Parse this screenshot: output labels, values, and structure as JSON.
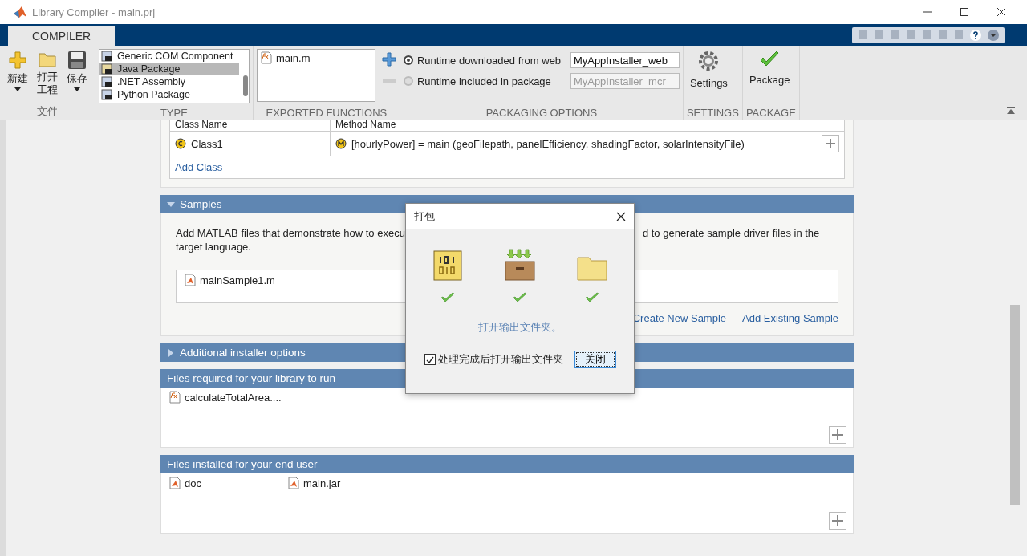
{
  "window": {
    "title": "Library Compiler - main.prj"
  },
  "ribbon": {
    "tabs": [
      {
        "label": "COMPILER",
        "selected": true
      }
    ],
    "file_group": {
      "label": "文件",
      "buttons": [
        {
          "label": "新建",
          "kind": "new",
          "dropdown": true
        },
        {
          "label": "打开工程",
          "kind": "open",
          "dropdown": false
        },
        {
          "label": "保存",
          "kind": "save",
          "dropdown": true
        }
      ]
    },
    "type_group": {
      "label": "TYPE",
      "items": [
        {
          "label": "Generic COM Component",
          "kind": "com",
          "selected": false
        },
        {
          "label": "Java Package",
          "kind": "java",
          "selected": true
        },
        {
          "label": ".NET Assembly",
          "kind": "net",
          "selected": false
        },
        {
          "label": "Python Package",
          "kind": "python",
          "selected": false
        }
      ]
    },
    "exported_functions": {
      "label": "EXPORTED FUNCTIONS",
      "files": [
        "main.m"
      ]
    },
    "packaging_options": {
      "label": "PACKAGING OPTIONS",
      "options": [
        {
          "label": "Runtime downloaded from web",
          "value": "MyAppInstaller_web",
          "selected": true
        },
        {
          "label": "Runtime included in package",
          "value": "MyAppInstaller_mcr",
          "selected": false
        }
      ]
    },
    "settings": {
      "label": "SETTINGS",
      "button": "Settings"
    },
    "package": {
      "label": "PACKAGE",
      "button": "Package"
    }
  },
  "class_table": {
    "columns": [
      "Class Name",
      "Method Name"
    ],
    "rows": [
      {
        "class": "Class1",
        "method": "[hourlyPower] = main (geoFilepath, panelEfficiency, shadingFactor, solarIntensityFile)"
      }
    ],
    "add_link": "Add Class"
  },
  "sections": [
    {
      "kind": "samples",
      "title": "Samples",
      "expanded": true,
      "description": "Add MATLAB files that demonstrate how to execu",
      "description_end": "d to generate sample driver files in the target language.",
      "files": [
        "mainSample1.m"
      ],
      "links": [
        "Create New Sample",
        "Add Existing Sample"
      ]
    },
    {
      "kind": "collapsible",
      "title": "Additional installer options",
      "expanded": false
    },
    {
      "kind": "files",
      "title": "Files required for your library to run",
      "files": [
        {
          "name": "calculateTotalArea....",
          "kind": "function"
        }
      ]
    },
    {
      "kind": "files",
      "title": "Files installed for your end user",
      "files": [
        {
          "name": "doc",
          "kind": "document"
        },
        {
          "name": "main.jar",
          "kind": "document"
        }
      ]
    }
  ],
  "dialog": {
    "title": "打包",
    "steps": [
      {
        "kind": "binary",
        "done": true
      },
      {
        "kind": "box",
        "done": true
      },
      {
        "kind": "folder",
        "done": true
      }
    ],
    "link": "打开输出文件夹。",
    "checkbox": {
      "label": "处理完成后打开输出文件夹",
      "checked": true
    },
    "button": "关闭"
  }
}
